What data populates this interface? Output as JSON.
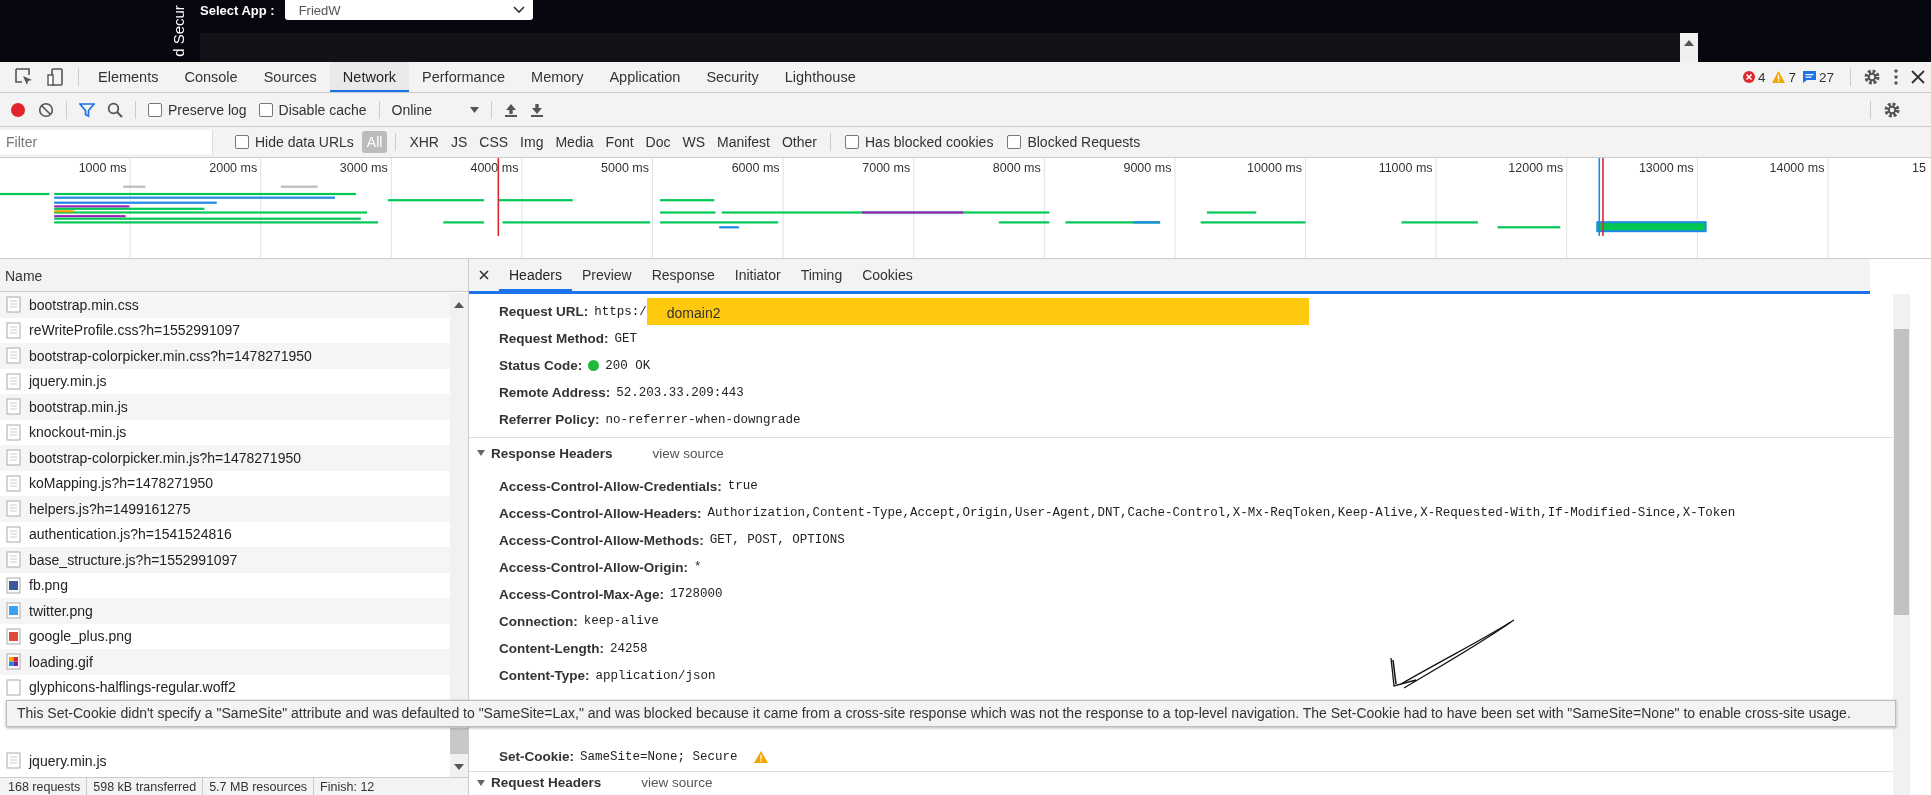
{
  "page": {
    "side_text": "d Secur",
    "select_label": "Select App :",
    "select_value": "FriedW"
  },
  "devtools": {
    "tabs": [
      {
        "label": "Elements",
        "selected": false
      },
      {
        "label": "Console",
        "selected": false
      },
      {
        "label": "Sources",
        "selected": false
      },
      {
        "label": "Network",
        "selected": true
      },
      {
        "label": "Performance",
        "selected": false
      },
      {
        "label": "Memory",
        "selected": false
      },
      {
        "label": "Application",
        "selected": false
      },
      {
        "label": "Security",
        "selected": false
      },
      {
        "label": "Lighthouse",
        "selected": false
      }
    ],
    "counts": {
      "errors": "4",
      "warnings": "7",
      "messages": "27"
    }
  },
  "toolbar": {
    "preserve_log": {
      "label": "Preserve log",
      "checked": false
    },
    "disable_cache": {
      "label": "Disable cache",
      "checked": false
    },
    "throttling": "Online"
  },
  "filter_bar": {
    "placeholder": "Filter",
    "hide_data_urls": {
      "label": "Hide data URLs",
      "checked": false
    },
    "types": [
      {
        "label": "All",
        "selected": true
      },
      {
        "label": "XHR",
        "selected": false
      },
      {
        "label": "JS",
        "selected": false
      },
      {
        "label": "CSS",
        "selected": false
      },
      {
        "label": "Img",
        "selected": false
      },
      {
        "label": "Media",
        "selected": false
      },
      {
        "label": "Font",
        "selected": false
      },
      {
        "label": "Doc",
        "selected": false
      },
      {
        "label": "WS",
        "selected": false
      },
      {
        "label": "Manifest",
        "selected": false
      },
      {
        "label": "Other",
        "selected": false
      }
    ],
    "has_blocked_cookies": {
      "label": "Has blocked cookies",
      "checked": false
    },
    "blocked_requests": {
      "label": "Blocked Requests",
      "checked": false
    }
  },
  "timeline": {
    "ticks": [
      "1000 ms",
      "2000 ms",
      "3000 ms",
      "4000 ms",
      "5000 ms",
      "6000 ms",
      "7000 ms",
      "8000 ms",
      "9000 ms",
      "10000 ms",
      "11000 ms",
      "12000 ms",
      "13000 ms",
      "14000 ms",
      "15"
    ]
  },
  "requests": {
    "column": "Name",
    "rows": [
      {
        "name": "bootstrap.min.css",
        "kind": "doc"
      },
      {
        "name": "reWriteProfile.css?h=1552991097",
        "kind": "doc"
      },
      {
        "name": "bootstrap-colorpicker.min.css?h=1478271950",
        "kind": "doc"
      },
      {
        "name": "jquery.min.js",
        "kind": "doc"
      },
      {
        "name": "bootstrap.min.js",
        "kind": "doc"
      },
      {
        "name": "knockout-min.js",
        "kind": "doc"
      },
      {
        "name": "bootstrap-colorpicker.min.js?h=1478271950",
        "kind": "doc"
      },
      {
        "name": "koMapping.js?h=1478271950",
        "kind": "doc"
      },
      {
        "name": "helpers.js?h=1499161275",
        "kind": "doc"
      },
      {
        "name": "authentication.js?h=1541524816",
        "kind": "doc"
      },
      {
        "name": "base_structure.js?h=1552991097",
        "kind": "doc"
      },
      {
        "name": "fb.png",
        "kind": "fb"
      },
      {
        "name": "twitter.png",
        "kind": "twitter"
      },
      {
        "name": "google_plus.png",
        "kind": "gplus"
      },
      {
        "name": "loading.gif",
        "kind": "gif"
      },
      {
        "name": "glyphicons-halflings-regular.woff2",
        "kind": "blank"
      }
    ],
    "last_row": {
      "name": "jquery.min.js",
      "kind": "doc"
    }
  },
  "status_bar": [
    "168 requests",
    "598 kB transferred",
    "5.7 MB resources",
    "Finish: 12"
  ],
  "details": {
    "tabs": [
      {
        "label": "Headers",
        "selected": true
      },
      {
        "label": "Preview",
        "selected": false
      },
      {
        "label": "Response",
        "selected": false
      },
      {
        "label": "Initiator",
        "selected": false
      },
      {
        "label": "Timing",
        "selected": false
      },
      {
        "label": "Cookies",
        "selected": false
      }
    ],
    "general": [
      {
        "name": "Request URL:",
        "value": "https:/",
        "redaction": "domain2"
      },
      {
        "name": "Request Method:",
        "value": "GET"
      },
      {
        "name": "Status Code:",
        "value": "200 OK",
        "color": "#22b83a"
      },
      {
        "name": "Remote Address:",
        "value": "52.203.33.209:443"
      },
      {
        "name": "Referrer Policy:",
        "value": "no-referrer-when-downgrade"
      }
    ],
    "response_headers": {
      "title": "Response Headers",
      "view_source": "view source",
      "expanded": true,
      "rows": [
        {
          "name": "Access-Control-Allow-Credentials:",
          "value": "true"
        },
        {
          "name": "Access-Control-Allow-Headers:",
          "value": "Authorization,Content-Type,Accept,Origin,User-Agent,DNT,Cache-Control,X-Mx-ReqToken,Keep-Alive,X-Requested-With,If-Modified-Since,X-Token"
        },
        {
          "name": "Access-Control-Allow-Methods:",
          "value": "GET, POST, OPTIONS"
        },
        {
          "name": "Access-Control-Allow-Origin:",
          "value": "*"
        },
        {
          "name": "Access-Control-Max-Age:",
          "value": "1728000"
        },
        {
          "name": "Connection:",
          "value": "keep-alive"
        },
        {
          "name": "Content-Length:",
          "value": "24258"
        },
        {
          "name": "Content-Type:",
          "value": "application/json"
        }
      ],
      "set_cookie": {
        "name": "Set-Cookie:",
        "value": "SameSite=None; Secure",
        "warning": true
      }
    },
    "request_headers": {
      "title": "Request Headers",
      "view_source": "view source",
      "expanded": true
    }
  },
  "tooltip": "This Set-Cookie didn't specify a \"SameSite\" attribute and was defaulted to \"SameSite=Lax,\" and was blocked because it came from a cross-site response which was not the response to a top-level navigation. The Set-Cookie had to have been set with \"SameSite=None\" to enable cross-site usage."
}
